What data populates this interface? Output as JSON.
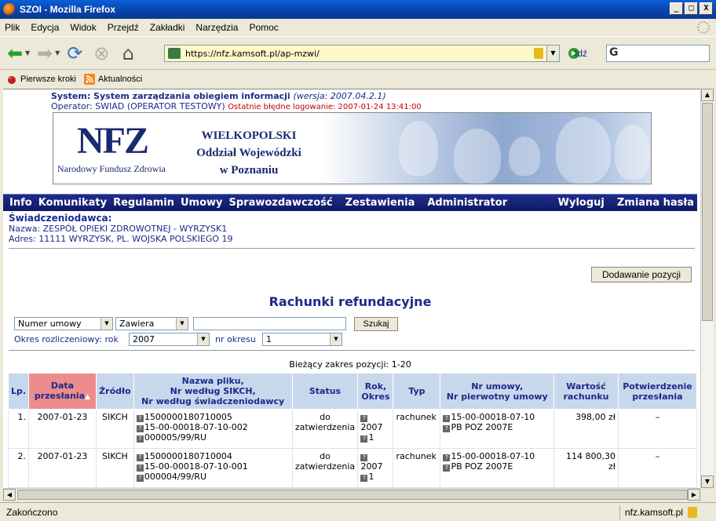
{
  "window": {
    "title": "SZOI - Mozilla Firefox",
    "min": "_",
    "max": "□",
    "close": "X"
  },
  "menu": [
    "Plik",
    "Edycja",
    "Widok",
    "Przejdź",
    "Zakładki",
    "Narzędzia",
    "Pomoc"
  ],
  "nav": {
    "url": "https://nfz.kamsoft.pl/ap-mzwi/",
    "go_label": "Idź",
    "search_glyph": "G"
  },
  "bookmarks": [
    "Pierwsze kroki",
    "Aktualności"
  ],
  "header": {
    "system_prefix": "System: System zarządzania obiegiem informacji",
    "version": "(wersja: 2007.04.2.1)",
    "operator": "Operator: SWIAD (OPERATOR TESTOWY)",
    "last_login": "Ostatnie błędne logowanie: 2007-01-24 13:41:00"
  },
  "banner": {
    "logo": "NFZ",
    "logo_sub": "Narodowy Fundusz Zdrowia",
    "region_1": "WIELKOPOLSKI",
    "region_2": "Oddział Wojewódzki",
    "region_3": "w Poznaniu"
  },
  "mainnav": {
    "left": [
      "Info",
      "Komunikaty",
      "Regulamin",
      "Umowy",
      "Sprawozdawczość",
      "Zestawienia",
      "Administrator"
    ],
    "right": [
      "Wyloguj",
      "Zmiana hasła"
    ]
  },
  "provider": {
    "heading": "Świadczeniodawca:",
    "name": "Nazwa: ZESPÓŁ OPIEKI ZDROWOTNEJ - WYRZYSK1",
    "address": "Adres: 11111 WYRZYSK, PL. WOJSKA POLSKIEGO 19"
  },
  "actions": {
    "add_label": "Dodawanie pozycji"
  },
  "page": {
    "title": "Rachunki refundacyjne"
  },
  "filters": {
    "field": "Numer umowy",
    "op": "Zawiera",
    "search_value": "",
    "search_label": "Szukaj",
    "period_label": "Okres rozliczeniowy: rok",
    "year": "2007",
    "period_nr_label": "nr okresu",
    "period_nr": "1"
  },
  "range": "Bieżący zakres pozycji: 1-20",
  "table": {
    "headers": {
      "lp": "Lp.",
      "date_1": "Data",
      "date_2": "przesłania",
      "source": "Źródło",
      "file_1": "Nazwa pliku,",
      "file_2": "Nr według SIKCH,",
      "file_3": "Nr według świadczeniodawcy",
      "status": "Status",
      "year_1": "Rok,",
      "year_2": "Okres",
      "type": "Typ",
      "contract_1": "Nr umowy,",
      "contract_2": "Nr pierwotny umowy",
      "value_1": "Wartość",
      "value_2": "rachunku",
      "confirm_1": "Potwierdzenie",
      "confirm_2": "przesłania"
    },
    "rows": [
      {
        "lp": "1.",
        "date": "2007-01-23",
        "source": "SIKCH",
        "file": "1500000180710005",
        "sikch": "15-00-00018-07-10-002",
        "prov": "000005/99/RU",
        "status_1": "do",
        "status_2": "zatwierdzenia",
        "year": "2007",
        "period": "1",
        "type": "rachunek",
        "contract": "15-00-00018-07-10",
        "orig": "PB POZ 2007E",
        "value": "398,00 zł",
        "confirm": "–"
      },
      {
        "lp": "2.",
        "date": "2007-01-23",
        "source": "SIKCH",
        "file": "1500000180710004",
        "sikch": "15-00-00018-07-10-001",
        "prov": "000004/99/RU",
        "status_1": "do",
        "status_2": "zatwierdzenia",
        "year": "2007",
        "period": "1",
        "type": "rachunek",
        "contract": "15-00-00018-07-10",
        "orig": "PB POZ 2007E",
        "value": "114 800,30 zł",
        "confirm": "–"
      }
    ]
  },
  "status": {
    "left": "Zakończono",
    "right": "nfz.kamsoft.pl"
  }
}
